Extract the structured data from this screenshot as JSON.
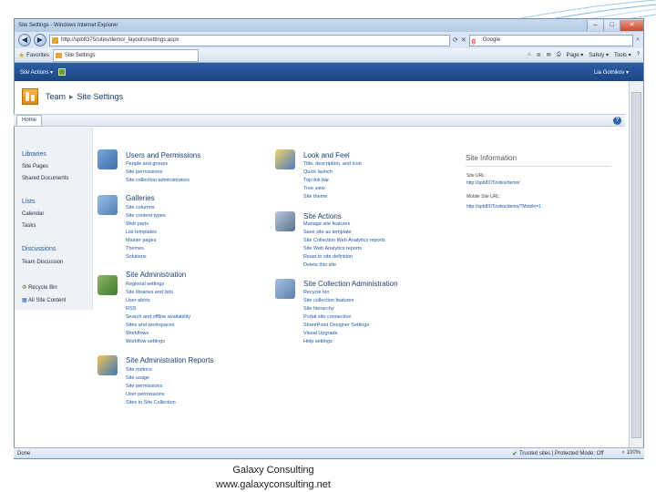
{
  "browser": {
    "title": "Site Settings - Windows Internet Explorer",
    "address": "http://spb8375/sites/demo/_layouts/settings.aspx",
    "search_placeholder": "Google",
    "favorites_label": "Favorites",
    "tab_label": "Site Settings",
    "commands": [
      "Page ▾",
      "Safety ▾",
      "Tools ▾",
      "?"
    ],
    "status_left": "Done",
    "status_zone": "Trusted sites | Protected Mode: Off",
    "zoom": "100%"
  },
  "ribbon": {
    "site_actions": "Site Actions ▾",
    "user": "Lia Gotnikov ▾"
  },
  "breadcrumb": {
    "site": "Team",
    "separator": "▸",
    "page": "Site Settings"
  },
  "topnav": {
    "home_tab": "Home",
    "help": "?"
  },
  "quicklaunch": {
    "libraries_heading": "Libraries",
    "libraries": [
      "Site Pages",
      "Shared Documents"
    ],
    "lists_heading": "Lists",
    "lists": [
      "Calendar",
      "Tasks"
    ],
    "discussions_heading": "Discussions",
    "discussions": [
      "Team Discussion"
    ],
    "recycle_bin": "Recycle Bin",
    "all_content": "All Site Content"
  },
  "sections": {
    "users": {
      "title": "Users and Permissions",
      "links": [
        "People and groups",
        "Site permissions",
        "Site collection administrators"
      ]
    },
    "galleries": {
      "title": "Galleries",
      "links": [
        "Site columns",
        "Site content types",
        "Web parts",
        "List templates",
        "Master pages",
        "Themes",
        "Solutions"
      ]
    },
    "site_admin": {
      "title": "Site Administration",
      "links": [
        "Regional settings",
        "Site libraries and lists",
        "User alerts",
        "RSS",
        "Search and offline availability",
        "Sites and workspaces",
        "Workflows",
        "Workflow settings"
      ]
    },
    "reports": {
      "title": "Site Administration Reports",
      "links": [
        "Site metrics",
        "Site usage",
        "Site permissions",
        "User permissions",
        "Sites in Site Collection"
      ]
    },
    "look_feel": {
      "title": "Look and Feel",
      "links": [
        "Title, description, and icon",
        "Quick launch",
        "Top link bar",
        "Tree view",
        "Site theme"
      ]
    },
    "site_actions": {
      "title": "Site Actions",
      "links": [
        "Manage site features",
        "Save site as template",
        "Site Collection Web Analytics reports",
        "Site Web Analytics reports",
        "Reset to site definition",
        "Delete this site"
      ]
    },
    "sc_admin": {
      "title": "Site Collection Administration",
      "links": [
        "Recycle bin",
        "Site collection features",
        "Site hierarchy",
        "Portal site connection",
        "SharePoint Designer Settings",
        "Visual Upgrade",
        "Help settings"
      ]
    }
  },
  "site_info": {
    "title": "Site Information",
    "url_label": "Site URL:",
    "url_value": "http://spb8375/sites/demo/",
    "mobile_label": "Mobile Site URL:",
    "mobile_value": "http://spb8375/sites/demo/?Mobile=1"
  },
  "footer": {
    "line1": "Galaxy Consulting",
    "line2": "www.galaxyconsulting.net"
  },
  "colors": {
    "ribbon": "#2c5da5",
    "link": "#1d57a6",
    "heading": "#1d3f6e"
  }
}
